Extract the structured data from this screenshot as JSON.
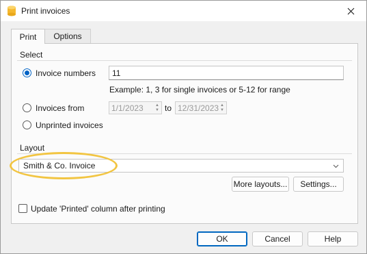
{
  "window": {
    "title": "Print invoices"
  },
  "tabs": [
    {
      "label": "Print",
      "active": true
    },
    {
      "label": "Options",
      "active": false
    }
  ],
  "select_group": {
    "label": "Select",
    "invoice_numbers": {
      "label": "Invoice numbers",
      "value": "11",
      "checked": true
    },
    "example_text": "Example: 1, 3 for single invoices or 5-12 for range",
    "invoices_from": {
      "label": "Invoices from",
      "from_date": "1/1/2023",
      "to_label": "to",
      "to_date": "12/31/2023",
      "checked": false
    },
    "unprinted": {
      "label": "Unprinted invoices",
      "checked": false
    }
  },
  "layout_group": {
    "label": "Layout",
    "selected_layout": "Smith & Co. Invoice",
    "more_layouts_label": "More layouts...",
    "settings_label": "Settings..."
  },
  "update_printed": {
    "label": "Update 'Printed' column after printing",
    "checked": false
  },
  "buttons": {
    "ok": "OK",
    "cancel": "Cancel",
    "help": "Help"
  },
  "colors": {
    "accent": "#0062c4",
    "highlight": "#f2c542",
    "app_icon": "#f5b82e"
  }
}
